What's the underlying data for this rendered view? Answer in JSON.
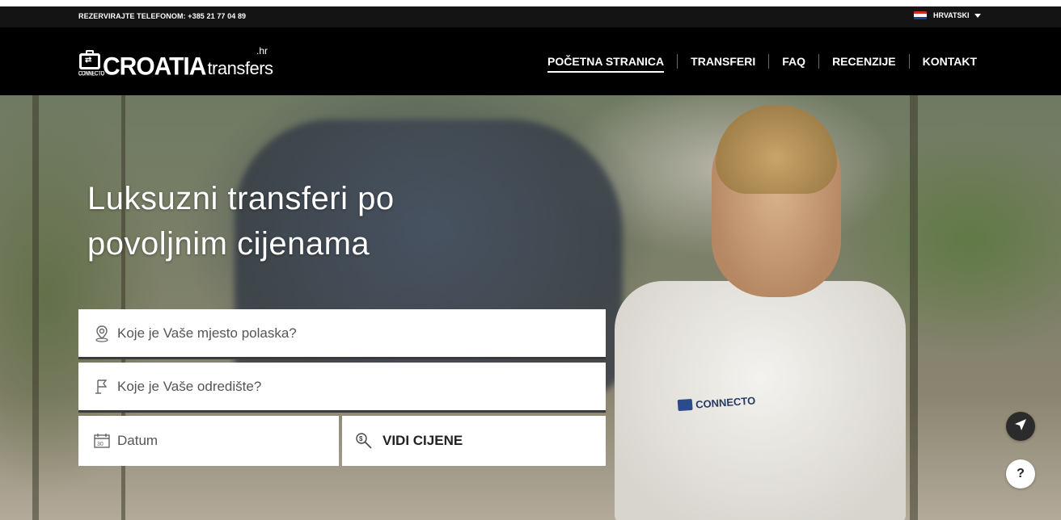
{
  "topbar": {
    "phone": "REZERVIRAJTE TELEFONOM: +385 21 77 04 89",
    "language": "HRVATSKI",
    "flag_colors": [
      "#d52b1e",
      "#ffffff",
      "#1f3d8f"
    ]
  },
  "logo": {
    "mark_sub": "CONNECTO",
    "main": "CROATIA",
    "sub": "transfers",
    "tld": ".hr"
  },
  "nav": {
    "items": [
      {
        "label": "POČETNA STRANICA",
        "active": true
      },
      {
        "label": "TRANSFERI"
      },
      {
        "label": "FAQ"
      },
      {
        "label": "RECENZIJE"
      },
      {
        "label": "KONTAKT"
      }
    ]
  },
  "hero": {
    "headline_line1": "Luksuzni transferi po",
    "headline_line2": "povoljnim cijenama",
    "shirt_logo": "CONNECTO"
  },
  "search": {
    "departure_placeholder": "Koje je Vaše mjesto polaska?",
    "destination_placeholder": "Koje je Vaše odredište?",
    "date_placeholder": "Datum",
    "date_icon_text": "30",
    "submit_label": "VIDI CIJENE"
  },
  "side_buttons": {
    "send_icon": "paper-plane-icon",
    "help_label": "?"
  }
}
